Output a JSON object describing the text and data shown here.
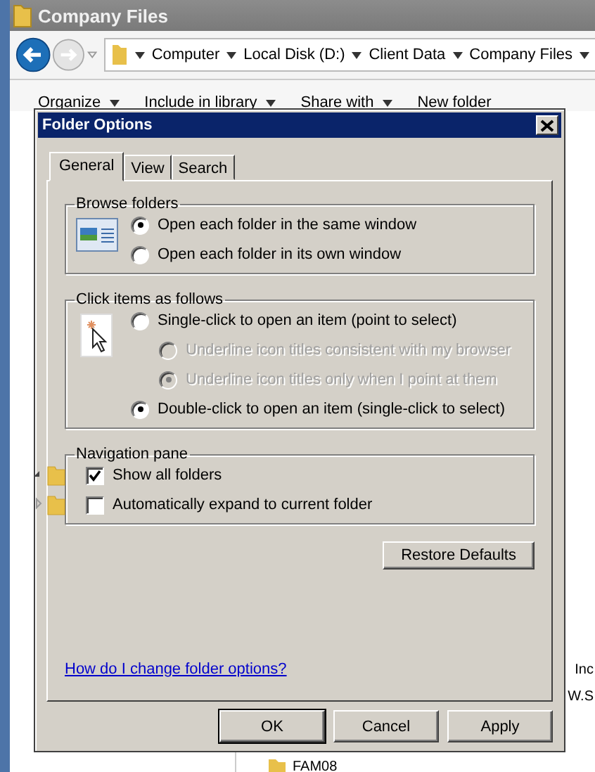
{
  "explorer": {
    "title": "Company Files",
    "breadcrumb": [
      "Computer",
      "Local Disk (D:)",
      "Client Data",
      "Company Files"
    ],
    "toolbar": [
      {
        "label": "Organize",
        "dropdown": true
      },
      {
        "label": "Include in library",
        "dropdown": true
      },
      {
        "label": "Share with",
        "dropdown": true
      },
      {
        "label": "New folder",
        "dropdown": false
      }
    ],
    "side_texts": [
      "Inc",
      "W.S"
    ],
    "folder_item": "FAM08"
  },
  "dialog": {
    "title": "Folder Options",
    "tabs": [
      {
        "label": "General",
        "selected": true
      },
      {
        "label": "View",
        "selected": false
      },
      {
        "label": "Search",
        "selected": false
      }
    ],
    "groups": [
      {
        "kind": "browse",
        "title": "Browse folders",
        "options": [
          {
            "kind": "radio",
            "label": "Open each folder in the same window",
            "selected": true,
            "disabled": false
          },
          {
            "kind": "radio",
            "label": "Open each folder in its own window",
            "selected": false,
            "disabled": false
          }
        ]
      },
      {
        "kind": "click",
        "title": "Click items as follows",
        "options": [
          {
            "kind": "radio",
            "label": "Single-click to open an item (point to select)",
            "selected": false,
            "disabled": false,
            "children": [
              {
                "kind": "radio",
                "label": "Underline icon titles consistent with my browser",
                "selected": false,
                "disabled": true
              },
              {
                "kind": "radio",
                "label": "Underline icon titles only when I point at them",
                "selected": true,
                "disabled": true
              }
            ]
          },
          {
            "kind": "radio",
            "label": "Double-click to open an item (single-click to select)",
            "selected": true,
            "disabled": false
          }
        ]
      },
      {
        "kind": "navigation",
        "title": "Navigation pane",
        "options": [
          {
            "kind": "checkbox",
            "label": "Show all folders",
            "checked": true,
            "disabled": false
          },
          {
            "kind": "checkbox",
            "label": "Automatically expand to current folder",
            "checked": false,
            "disabled": false
          }
        ]
      }
    ],
    "restore_button": "Restore Defaults",
    "help_link": "How do I change folder options?",
    "buttons": [
      {
        "label": "OK",
        "default": true
      },
      {
        "label": "Cancel",
        "default": false
      },
      {
        "label": "Apply",
        "default": false
      }
    ]
  }
}
